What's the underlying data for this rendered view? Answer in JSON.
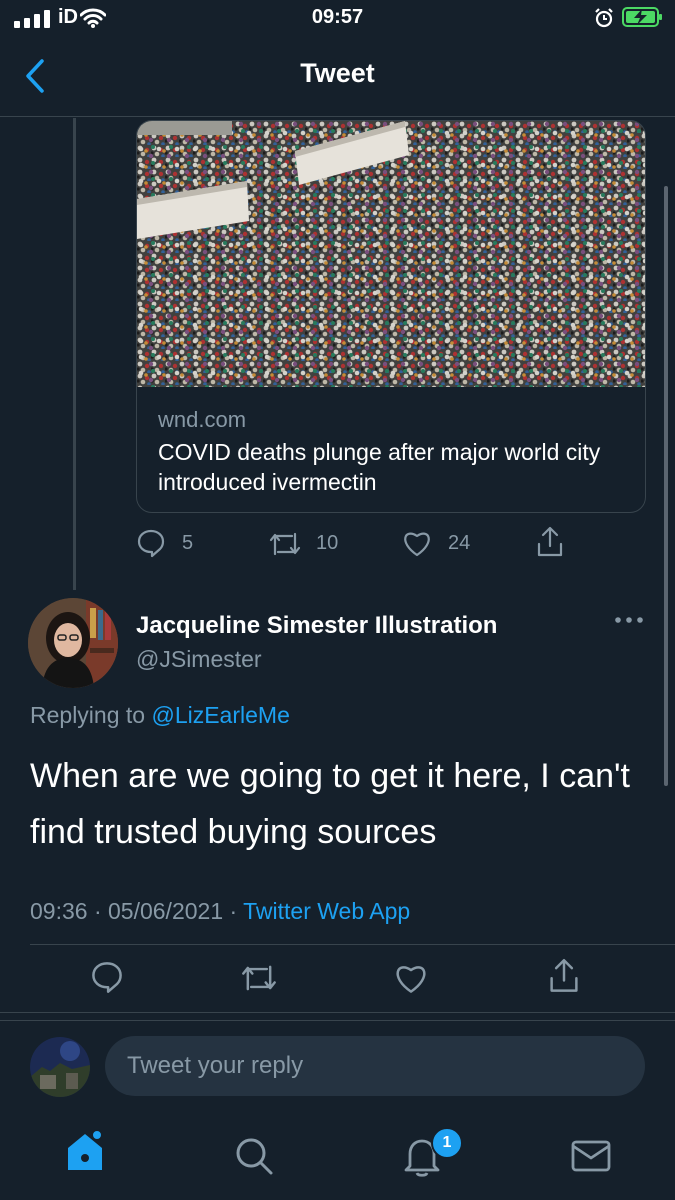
{
  "status_bar": {
    "carrier": "iD",
    "time": "09:57",
    "icons": [
      "signal-icon",
      "wifi-icon",
      "alarm-icon",
      "battery-charging-icon"
    ]
  },
  "header": {
    "title": "Tweet",
    "back_icon": "chevron-left-icon"
  },
  "link_card": {
    "domain": "wnd.com",
    "title": "COVID deaths plunge after major world city introduced ivermectin",
    "image": "aerial photo of large crowd"
  },
  "parent_actions": {
    "replies": "5",
    "retweets": "10",
    "likes": "24"
  },
  "tweet": {
    "name": "Jacqueline Simester Illustration",
    "handle": "@JSimester",
    "replying_prefix": "Replying to ",
    "replying_to": "@LizEarleMe",
    "text": "When are we going to get it here, I can't find trusted buying sources",
    "time": "09:36 · 05/06/2021 · ",
    "app": "Twitter Web App"
  },
  "reply_box": {
    "placeholder": "Tweet your reply"
  },
  "tab_bar": {
    "notification_count": "1",
    "items": [
      "home-icon",
      "search-icon",
      "notifications-icon",
      "messages-icon"
    ]
  },
  "colors": {
    "background": "#15202b",
    "accent": "#1da1f2",
    "secondary_text": "#8899a6",
    "border": "#38444d",
    "battery": "#4cd964"
  }
}
